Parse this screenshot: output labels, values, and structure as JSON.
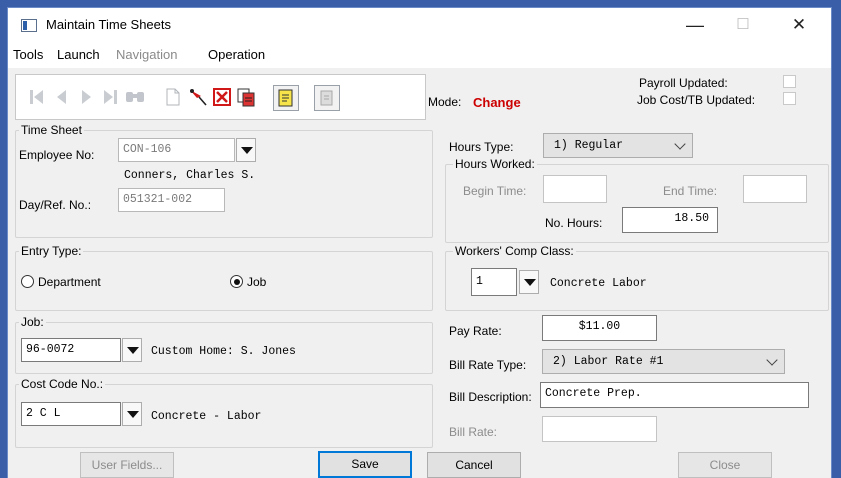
{
  "window": {
    "title": "Maintain Time Sheets",
    "minimize": "—",
    "maximize": "☐",
    "close": "✕"
  },
  "menu": {
    "tools": "Tools",
    "launch": "Launch",
    "navigation": "Navigation",
    "operation": "Operation"
  },
  "toolbar": {
    "icons": [
      "first-record-icon",
      "prev-record-icon",
      "next-record-icon",
      "last-record-icon",
      "find-binoculars-icon",
      "new-record-icon",
      "post-pin-icon",
      "delete-icon",
      "copy-record-icon",
      "notes-icon",
      "print-icon"
    ]
  },
  "mode": {
    "label": "Mode:",
    "value": "Change",
    "value_color": "#cc0000"
  },
  "flags": {
    "payroll_updated": "Payroll Updated:",
    "jobcost_updated": "Job Cost/TB Updated:"
  },
  "timesheet": {
    "group_label": "Time Sheet",
    "employee_label": "Employee No:",
    "employee_value": "CON-106",
    "employee_name": "Conners, Charles S.",
    "dayref_label": "Day/Ref. No.:",
    "dayref_value": "051321-002"
  },
  "entry_type": {
    "group_label": "Entry Type:",
    "department_label": "Department",
    "job_label": "Job",
    "selected": "Job"
  },
  "job": {
    "group_label": "Job:",
    "value": "96-0072",
    "description": "Custom Home: S. Jones"
  },
  "cost_code": {
    "group_label": "Cost Code No.:",
    "value": "2 C L",
    "description": "Concrete - Labor"
  },
  "hours": {
    "type_label": "Hours Type:",
    "type_value": "1) Regular",
    "worked_label": "Hours Worked:",
    "begin_label": "Begin Time:",
    "begin_value": "",
    "end_label": "End Time:",
    "end_value": "",
    "no_hours_label": "No. Hours:",
    "no_hours_value": "18.50"
  },
  "workers_comp": {
    "group_label": "Workers' Comp Class:",
    "value": "1",
    "description": "Concrete Labor"
  },
  "pay": {
    "pay_rate_label": "Pay Rate:",
    "pay_rate_value": "$11.00",
    "bill_rate_type_label": "Bill Rate Type:",
    "bill_rate_type_value": "2) Labor Rate #1",
    "bill_description_label": "Bill Description:",
    "bill_description_value": "Concrete Prep.",
    "bill_rate_label": "Bill Rate:",
    "bill_rate_value": ""
  },
  "buttons": {
    "user_fields": "User Fields...",
    "save": "Save",
    "cancel": "Cancel",
    "close": "Close"
  }
}
